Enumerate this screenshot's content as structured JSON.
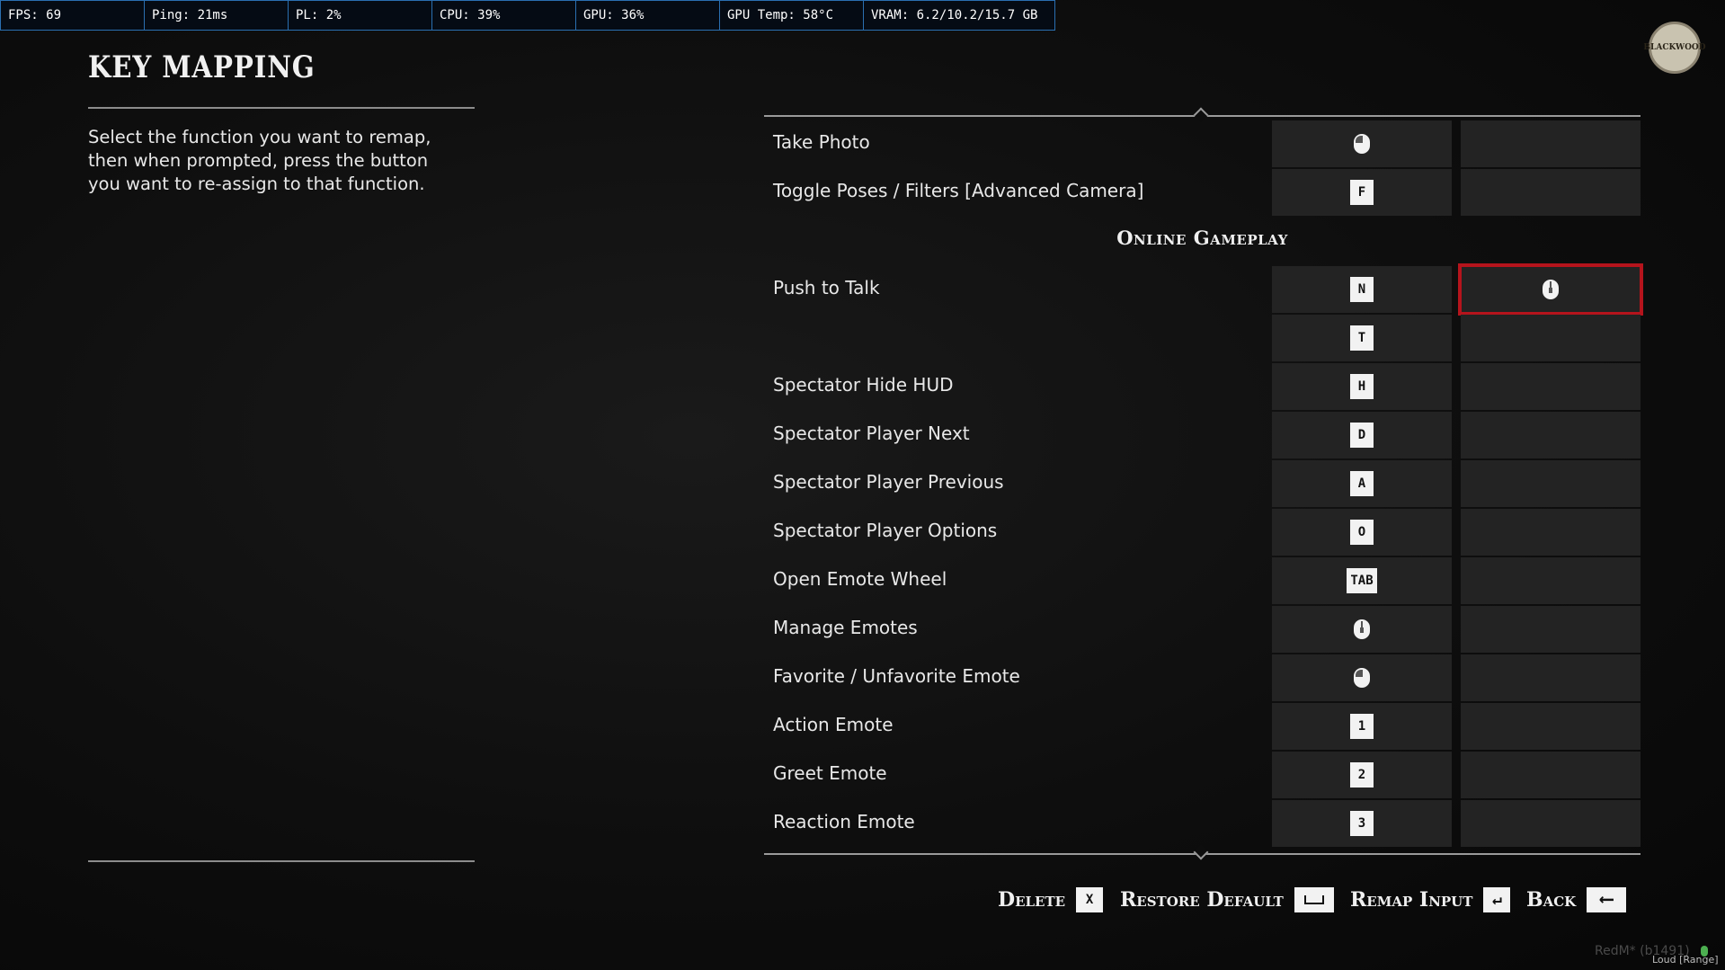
{
  "perf": [
    {
      "name": "fps",
      "text": "FPS: 69"
    },
    {
      "name": "ping",
      "text": "Ping: 21ms"
    },
    {
      "name": "pl",
      "text": "PL: 2%"
    },
    {
      "name": "cpu",
      "text": "CPU: 39%"
    },
    {
      "name": "gpu",
      "text": "GPU: 36%"
    },
    {
      "name": "gpu-temp",
      "text": "GPU Temp: 58°C"
    },
    {
      "name": "vram",
      "text": "VRAM: 6.2/10.2/15.7 GB"
    }
  ],
  "logo": {
    "text": "BLACKWOOD"
  },
  "page": {
    "title": "KEY MAPPING",
    "description": "Select the function you want to remap, then when prompted, press the button you want to re-assign to that function."
  },
  "section": {
    "title": "Online Gameplay"
  },
  "rows": [
    {
      "label": "Take Photo",
      "primary": {
        "type": "mouse",
        "variant": "left"
      },
      "secondary": null
    },
    {
      "label": "Toggle Poses / Filters [Advanced Camera]",
      "primary": {
        "type": "key",
        "text": "F"
      },
      "secondary": null
    },
    {
      "label": "Push to Talk",
      "primary": {
        "type": "key",
        "text": "N"
      },
      "secondary": {
        "type": "mouse",
        "variant": "mid"
      },
      "selected": "secondary"
    },
    {
      "label": "",
      "primary": {
        "type": "key",
        "text": "T"
      },
      "secondary": null
    },
    {
      "label": "Spectator Hide HUD",
      "primary": {
        "type": "key",
        "text": "H"
      },
      "secondary": null
    },
    {
      "label": "Spectator Player Next",
      "primary": {
        "type": "key",
        "text": "D"
      },
      "secondary": null
    },
    {
      "label": "Spectator Player Previous",
      "primary": {
        "type": "key",
        "text": "A"
      },
      "secondary": null
    },
    {
      "label": "Spectator Player Options",
      "primary": {
        "type": "key",
        "text": "O"
      },
      "secondary": null
    },
    {
      "label": "Open Emote Wheel",
      "primary": {
        "type": "key",
        "text": "TAB"
      },
      "secondary": null
    },
    {
      "label": "Manage Emotes",
      "primary": {
        "type": "mouse",
        "variant": "mid"
      },
      "secondary": null
    },
    {
      "label": "Favorite / Unfavorite Emote",
      "primary": {
        "type": "mouse",
        "variant": "left"
      },
      "secondary": null
    },
    {
      "label": "Action Emote",
      "primary": {
        "type": "key",
        "text": "1"
      },
      "secondary": null
    },
    {
      "label": "Greet Emote",
      "primary": {
        "type": "key",
        "text": "2"
      },
      "secondary": null
    },
    {
      "label": "Reaction Emote",
      "primary": {
        "type": "key",
        "text": "3"
      },
      "secondary": null
    }
  ],
  "footer": {
    "delete_label": "Delete",
    "delete_key": "X",
    "restore_label": "Restore Default",
    "remap_label": "Remap Input",
    "back_label": "Back"
  },
  "build": {
    "text": "RedM* (b1491)",
    "voice": "Loud [Range]"
  },
  "colors": {
    "selected_outline": "#b5141c",
    "overlay_border": "#2a6fb0"
  }
}
